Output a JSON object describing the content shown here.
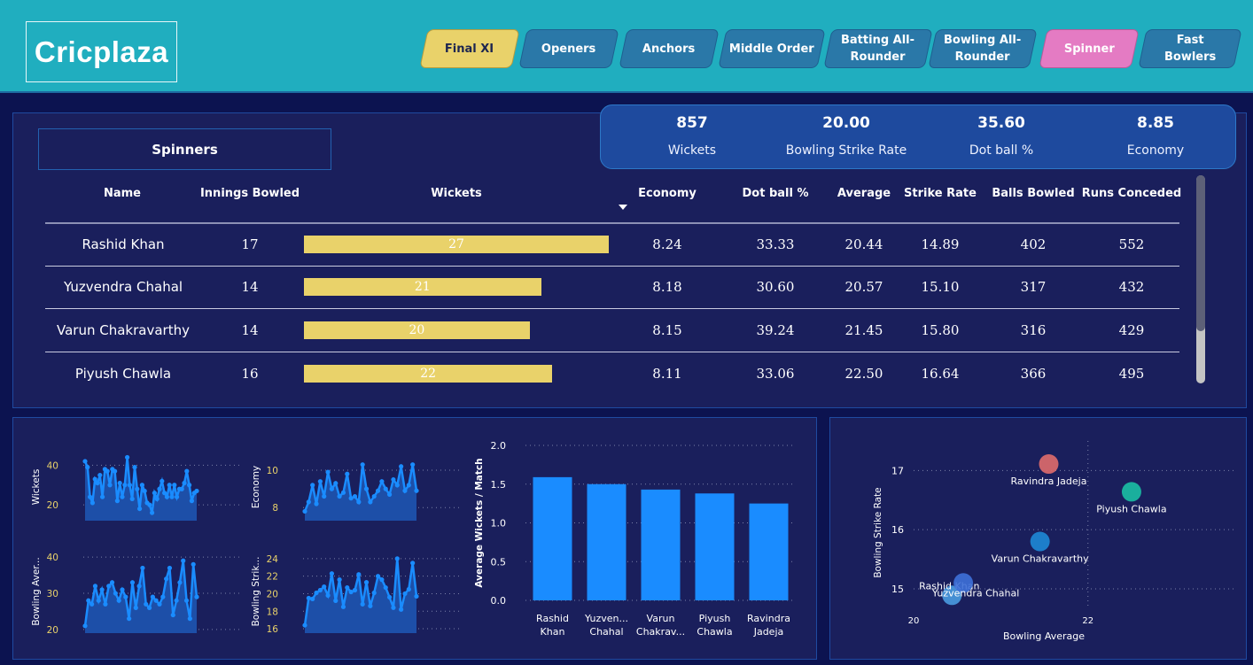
{
  "header": {
    "logo": "Cricplaza",
    "tabs": [
      {
        "label": "Final XI",
        "style": "final"
      },
      {
        "label": "Openers",
        "style": "default"
      },
      {
        "label": "Anchors",
        "style": "default"
      },
      {
        "label": "Middle Order",
        "style": "default"
      },
      {
        "label": "Batting All-\nRounder",
        "style": "default"
      },
      {
        "label": "Bowling All-\nRounder",
        "style": "default"
      },
      {
        "label": "Spinner",
        "style": "spin"
      },
      {
        "label": "Fast\nBowlers",
        "style": "default"
      }
    ]
  },
  "section_title": "Spinners",
  "kpis": [
    {
      "value": "857",
      "label": "Wickets"
    },
    {
      "value": "20.00",
      "label": "Bowling Strike Rate"
    },
    {
      "value": "35.60",
      "label": "Dot ball %"
    },
    {
      "value": "8.85",
      "label": "Economy"
    }
  ],
  "table": {
    "columns": [
      "Name",
      "Innings Bowled",
      "Wickets",
      "Economy",
      "Dot ball %",
      "Average",
      "Strike Rate",
      "Balls Bowled",
      "Runs Conceded"
    ],
    "sorted_column": "Wickets",
    "rows": [
      {
        "name": "Rashid Khan",
        "innings": "17",
        "wickets": 27,
        "economy": "8.24",
        "dot": "33.33",
        "average": "20.44",
        "sr": "14.89",
        "balls": "402",
        "runs": "552"
      },
      {
        "name": "Yuzvendra Chahal",
        "innings": "14",
        "wickets": 21,
        "economy": "8.18",
        "dot": "30.60",
        "average": "20.57",
        "sr": "15.10",
        "balls": "317",
        "runs": "432"
      },
      {
        "name": "Varun Chakravarthy",
        "innings": "14",
        "wickets": 20,
        "economy": "8.15",
        "dot": "39.24",
        "average": "21.45",
        "sr": "15.80",
        "balls": "316",
        "runs": "429"
      },
      {
        "name": "Piyush Chawla",
        "innings": "16",
        "wickets": 22,
        "economy": "8.11",
        "dot": "33.06",
        "average": "22.50",
        "sr": "16.64",
        "balls": "366",
        "runs": "495"
      }
    ],
    "bar_color": "#e9d26a",
    "bar_max": 27
  },
  "colors": {
    "tab_active": "#e9d26a",
    "tab_spinner": "#e47bc3",
    "series_blue": "#1a8cff",
    "header_bg": "#20aebf"
  },
  "chart_data": [
    {
      "type": "area",
      "ylabel": "Wickets",
      "yticks": [
        20,
        40
      ],
      "ylim": [
        12,
        46
      ],
      "values": [
        42,
        39,
        24,
        21,
        33,
        31,
        35,
        24,
        38,
        37,
        30,
        38,
        37,
        22,
        31,
        24,
        30,
        44,
        30,
        23,
        39,
        28,
        18,
        30,
        27,
        21,
        20,
        16,
        26,
        23,
        28,
        32,
        26,
        24,
        30,
        24,
        30,
        24,
        28,
        28,
        31,
        37,
        30,
        22,
        26,
        27
      ]
    },
    {
      "type": "area",
      "ylabel": "Economy",
      "yticks": [
        8,
        10
      ],
      "ylim": [
        7.3,
        10.9
      ],
      "values": [
        7.8,
        8.3,
        9.2,
        8.2,
        9.4,
        8.6,
        9.9,
        9.0,
        9.3,
        8.6,
        8.8,
        9.8,
        8.5,
        8.6,
        8.3,
        10.3,
        9.0,
        8.3,
        8.6,
        8.9,
        9.4,
        9.0,
        8.7,
        9.5,
        9.2,
        10.2,
        8.9,
        9.2,
        10.3,
        8.9
      ]
    },
    {
      "type": "area",
      "ylabel": "Bowling Aver...",
      "yticks": [
        20,
        30,
        40
      ],
      "ylim": [
        19,
        42
      ],
      "values": [
        21,
        28,
        27,
        32,
        28,
        31,
        27,
        32,
        33,
        30,
        28,
        31,
        29,
        23,
        33,
        26,
        32,
        37,
        27,
        26,
        29,
        28,
        27,
        29,
        34,
        37,
        24,
        28,
        33,
        39,
        28,
        23,
        38,
        29
      ]
    },
    {
      "type": "area",
      "ylabel": "Bowling Strik...",
      "yticks": [
        16,
        18,
        20,
        22,
        24
      ],
      "ylim": [
        15.5,
        25
      ],
      "values": [
        16.4,
        19.5,
        19.4,
        20.1,
        20.4,
        20.8,
        19.8,
        22.3,
        19.2,
        21.6,
        18.5,
        20.7,
        20.2,
        20.4,
        22.2,
        18.8,
        21.3,
        18.6,
        20.1,
        22.0,
        21.6,
        20.7,
        19.6,
        18.4,
        24.0,
        18.2,
        20.0,
        20.5,
        23.5,
        19.7
      ]
    },
    {
      "type": "bar",
      "ylabel": "Average Wickets / Match",
      "ylim": [
        0,
        2.0
      ],
      "yticks": [
        "0.0",
        "0.5",
        "1.0",
        "1.5",
        "2.0"
      ],
      "categories": [
        "Rashid\nKhan",
        "Yuzven...\nChahal",
        "Varun\nChakrav...",
        "Piyush\nChawla",
        "Ravindra\nJadeja"
      ],
      "values": [
        1.59,
        1.5,
        1.43,
        1.38,
        1.25
      ]
    },
    {
      "type": "scatter",
      "xlabel": "Bowling Average",
      "ylabel": "Bowling Strike Rate",
      "xlim": [
        20,
        23.7
      ],
      "ylim": [
        14.7,
        17.5
      ],
      "xticks": [
        20,
        22
      ],
      "yticks": [
        15,
        16,
        17
      ],
      "points": [
        {
          "label": "Ravindra Jadeja",
          "x": 21.55,
          "y": 17.11,
          "color": "#e06b6b"
        },
        {
          "label": "Piyush Chawla",
          "x": 22.5,
          "y": 16.64,
          "color": "#1bbfa4"
        },
        {
          "label": "Varun Chakravarthy",
          "x": 21.45,
          "y": 15.8,
          "color": "#1e88d6"
        },
        {
          "label": "Rashid Khan",
          "x": 20.44,
          "y": 14.89,
          "color": "#4a9be0"
        },
        {
          "label": "Yuzvendra Chahal",
          "x": 20.57,
          "y": 15.1,
          "color": "#3e70d8"
        }
      ]
    }
  ]
}
